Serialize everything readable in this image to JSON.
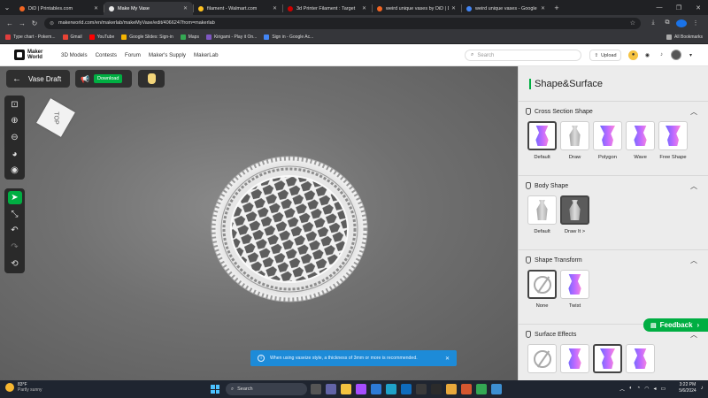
{
  "browser": {
    "tabs": [
      {
        "title": "DiD | Printables.com",
        "icon_color": "#f26522",
        "active": false
      },
      {
        "title": "Make My Vase",
        "icon_color": "#1b1b1b",
        "active": true
      },
      {
        "title": "filament - Walmart.com",
        "icon_color": "#ffc220",
        "active": false
      },
      {
        "title": "3d Printer Filament : Target",
        "icon_color": "#cc0000",
        "active": false
      },
      {
        "title": "weird unique vases by DiD | D...",
        "icon_color": "#f26522",
        "active": false
      },
      {
        "title": "weird unique vases - Google S...",
        "icon_color": "#4285f4",
        "active": false
      }
    ],
    "tab_close": "✕",
    "new_tab": "+",
    "address": "makerworld.com/en/makerlab/makeMyVase/edit/4066247from=makerlab",
    "bookmarks": [
      {
        "label": "Type chart - Pokem...",
        "icon_color": "#e03d3d"
      },
      {
        "label": "Gmail",
        "icon_color": "#ea4335"
      },
      {
        "label": "YouTube",
        "icon_color": "#ff0000"
      },
      {
        "label": "Google Slides: Sign-in",
        "icon_color": "#f4b400"
      },
      {
        "label": "Maps",
        "icon_color": "#34a853"
      },
      {
        "label": "Kirigami - Play it On...",
        "icon_color": "#7e57c2"
      },
      {
        "label": "Sign in - Google Ac...",
        "icon_color": "#4285f4"
      }
    ],
    "all_bookmarks": "All Bookmarks"
  },
  "site": {
    "logo_text": "Maker World",
    "nav": [
      "3D Models",
      "Contests",
      "Forum",
      "Maker's Supply",
      "MakerLab"
    ],
    "search_placeholder": "Search",
    "upload_label": "Upload"
  },
  "editor": {
    "back_label": "Vase Draft",
    "download_label": "Download",
    "cube_label": "TOP",
    "toast_text": "When using vaseize style, a thickness of 3mm or more is recommended.",
    "toast_close": "✕"
  },
  "panel": {
    "title": "Shape&Surface",
    "sections": [
      {
        "title": "Cross Section Shape",
        "options": [
          "Default",
          "Draw",
          "Polygon",
          "Wave",
          "Free Shape"
        ]
      },
      {
        "title": "Body Shape",
        "options": [
          "Default",
          "Draw It >"
        ]
      },
      {
        "title": "Shape Transform",
        "options": [
          "None",
          "Twist"
        ]
      },
      {
        "title": "Surface Effects",
        "options": []
      }
    ],
    "feedback_label": "Feedback"
  },
  "taskbar": {
    "weather_temp": "83°F",
    "weather_desc": "Partly sunny",
    "search_label": "Search",
    "time": "3:22 PM",
    "date": "5/6/2024"
  },
  "colors": {
    "accent": "#00ae42",
    "toast": "#1d8bd8"
  }
}
